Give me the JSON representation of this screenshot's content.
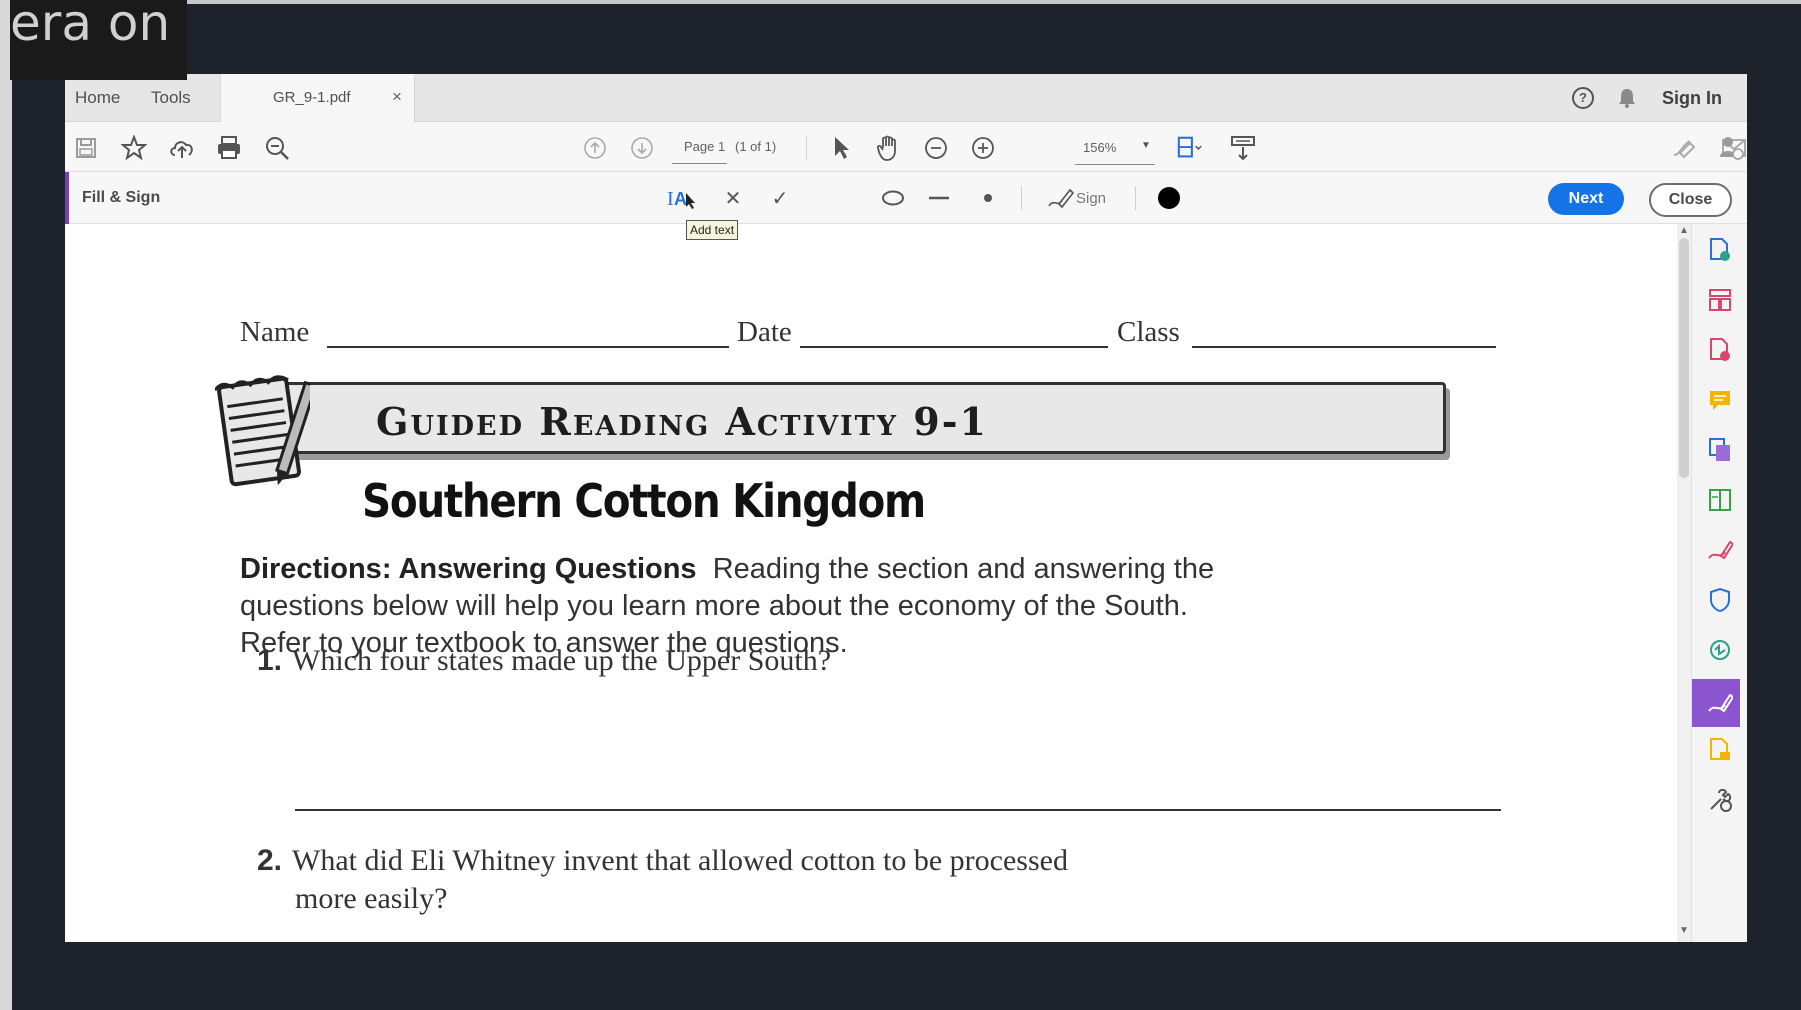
{
  "overlay": {
    "text": "era on"
  },
  "tabs": {
    "home": "Home",
    "tools": "Tools",
    "file": "GR_9-1.pdf",
    "close": "×"
  },
  "header": {
    "help": "?",
    "sign_in": "Sign In"
  },
  "toolbar": {
    "page_field": "Page 1",
    "page_of": "(1 of 1)",
    "zoom": "156%"
  },
  "fill_sign": {
    "title": "Fill & Sign",
    "sign_label": "Sign",
    "next_label": "Next",
    "close_label": "Close",
    "tooltip": "Add text"
  },
  "document": {
    "name_label": "Name",
    "date_label": "Date",
    "class_label": "Class",
    "banner_title": "Guided Reading Activity 9-1",
    "section_title": "Southern Cotton Kingdom",
    "directions_bold": "Directions: Answering Questions",
    "directions_text": "Reading the section and answering the questions below will help you learn more about the economy of the South. Refer to your textbook to answer the questions.",
    "questions": [
      {
        "num": "1.",
        "text": "Which four states made up the Upper South?"
      },
      {
        "num": "2.",
        "text": "What did Eli Whitney invent that allowed cotton to be processed"
      },
      {
        "num": "",
        "text": "more easily?"
      }
    ]
  },
  "colors": {
    "accent_blue": "#1473e6",
    "fill_sign_purple": "#7a3fbf",
    "rail_active": "#8a55cf"
  }
}
